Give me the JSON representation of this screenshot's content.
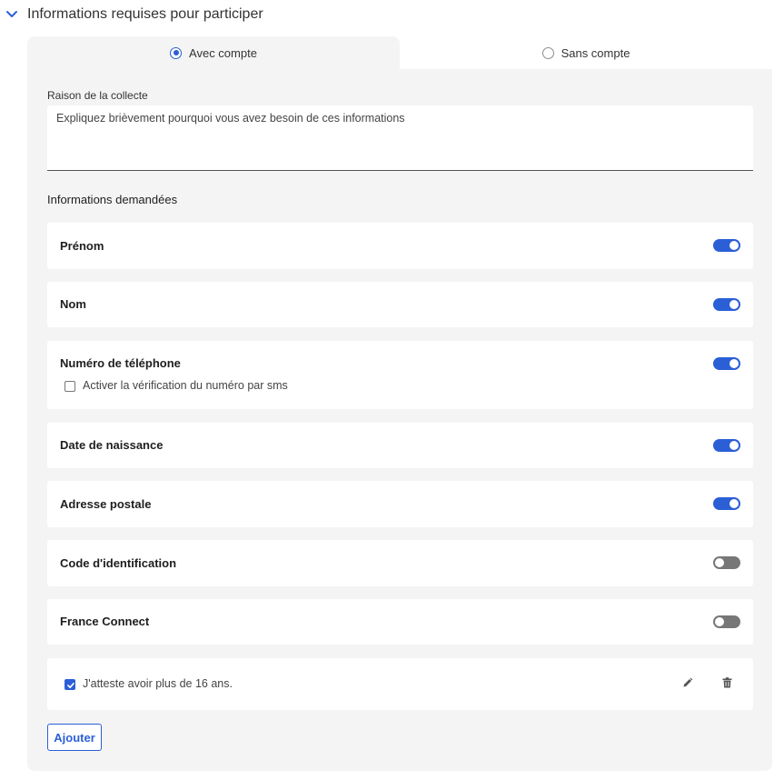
{
  "section": {
    "title": "Informations requises pour participer"
  },
  "tabs": [
    {
      "label": "Avec compte",
      "selected": true
    },
    {
      "label": "Sans compte",
      "selected": false
    }
  ],
  "reason": {
    "label": "Raison de la collecte",
    "placeholder": "Expliquez brièvement pourquoi vous avez besoin de ces informations"
  },
  "requested": {
    "label": "Informations demandées",
    "fields": [
      {
        "label": "Prénom",
        "enabled": true
      },
      {
        "label": "Nom",
        "enabled": true
      },
      {
        "label": "Numéro de téléphone",
        "enabled": true,
        "option_label": "Activer la vérification du numéro par sms",
        "option_checked": false
      },
      {
        "label": "Date de naissance",
        "enabled": true
      },
      {
        "label": "Adresse postale",
        "enabled": true
      },
      {
        "label": "Code d'identification",
        "enabled": false
      },
      {
        "label": "France Connect",
        "enabled": false
      }
    ]
  },
  "custom_checkbox": {
    "label": "J'atteste avoir plus de 16 ans.",
    "checked": true
  },
  "add_button": {
    "label": "Ajouter"
  },
  "colors": {
    "accent": "#2a5fd6",
    "panel_bg": "#f4f4f4",
    "toggle_off": "#777777"
  }
}
